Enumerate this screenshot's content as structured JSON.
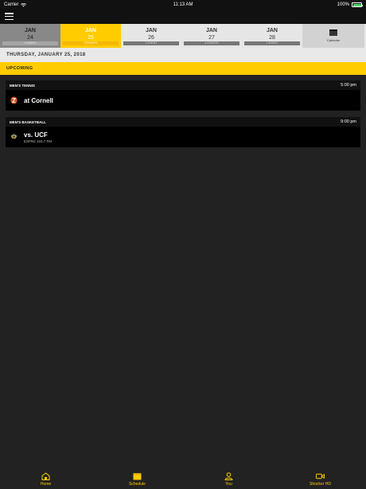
{
  "statusbar": {
    "carrier": "Carrier",
    "time": "11:13 AM",
    "battery": "100%"
  },
  "datebar": {
    "dates": [
      {
        "month": "JAN",
        "day": "24",
        "events": "1 EVENT",
        "state": "past"
      },
      {
        "month": "JAN",
        "day": "25",
        "events": "2 EVENTS",
        "state": "selected"
      },
      {
        "month": "JAN",
        "day": "26",
        "events": "1 EVENT",
        "state": "normal"
      },
      {
        "month": "JAN",
        "day": "27",
        "events": "4 EVENTS",
        "state": "normal"
      },
      {
        "month": "JAN",
        "day": "28",
        "events": "1 EVENT",
        "state": "normal"
      }
    ],
    "calendar_label": "Calendar"
  },
  "date_heading": "THURSDAY, JANUARY 25, 2018",
  "section_label": "UPCOMING",
  "events": [
    {
      "sport": "MEN'S TENNIS",
      "time": "5:00 pm",
      "opponent": "at Cornell",
      "broadcast": ""
    },
    {
      "sport": "MEN'S BASKETBALL",
      "time": "9:00 pm",
      "opponent": "vs. UCF",
      "broadcast": "ESPN2 103.7 FM"
    }
  ],
  "tabbar": {
    "home": "Home",
    "schedule": "Schedule",
    "you": "You",
    "video": "Shocker HD"
  },
  "colors": {
    "accent": "#ffcc00",
    "background": "#222222",
    "card": "#000000",
    "battery": "#4cd964"
  }
}
